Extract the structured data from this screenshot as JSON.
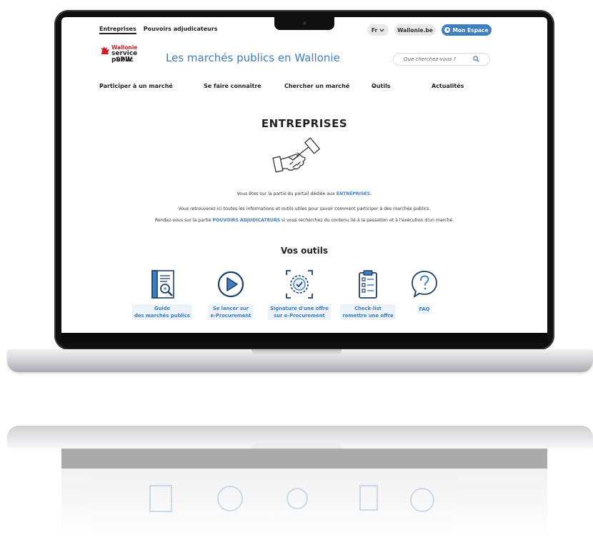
{
  "site": {
    "top_nav": [
      "Entreprises",
      "Pouvoirs adjudicateurs"
    ],
    "lang": "Fr",
    "wallonie_link": "Wallonie.be",
    "espace_button": "Mon Espace",
    "logo": {
      "line1": "Wallonie",
      "line2": "service public",
      "line3": "SPW"
    },
    "title": "Les marchés publics en Wallonie",
    "search_placeholder": "Que cherchez-vous ?",
    "main_nav": [
      "Participer à un marché",
      "Se faire connaître",
      "Chercher un marché",
      "Outils",
      "Actualités"
    ],
    "page_title": "ENTREPRISES",
    "intro": {
      "p1_before": "Vous êtes sur la partie du portail dédiée aux",
      "p1_link": "ENTREPRISES.",
      "p2": "Vous retrouverez ici toutes les informations et outils utiles pour savoir comment participer à des marchés publics.",
      "p3_before": "Rendez-vous sur la partie",
      "p3_link": "POUVOIRS ADJUDICATEURS",
      "p3_after": "si vous recherchez du contenu lié à la passation et à l'exécution d'un marché."
    },
    "tools_title": "Vos outils",
    "tools": [
      {
        "icon": "guide-book-icon",
        "line1": "Guide",
        "line2": "des marchés publics"
      },
      {
        "icon": "play-icon",
        "line1": "Se lancer sur",
        "line2": "e-Procurement"
      },
      {
        "icon": "signature-seal-icon",
        "line1": "Signature d'une offre",
        "line2": "sur e-Procurement"
      },
      {
        "icon": "checklist-icon",
        "line1": "Check-list",
        "line2": "remettre une offre"
      },
      {
        "icon": "faq-icon",
        "line1": "FAQ",
        "line2": ""
      }
    ]
  },
  "colors": {
    "accent": "#3f7fc0",
    "brand_red": "#d31c28",
    "laptop_bezel": "#101010"
  }
}
